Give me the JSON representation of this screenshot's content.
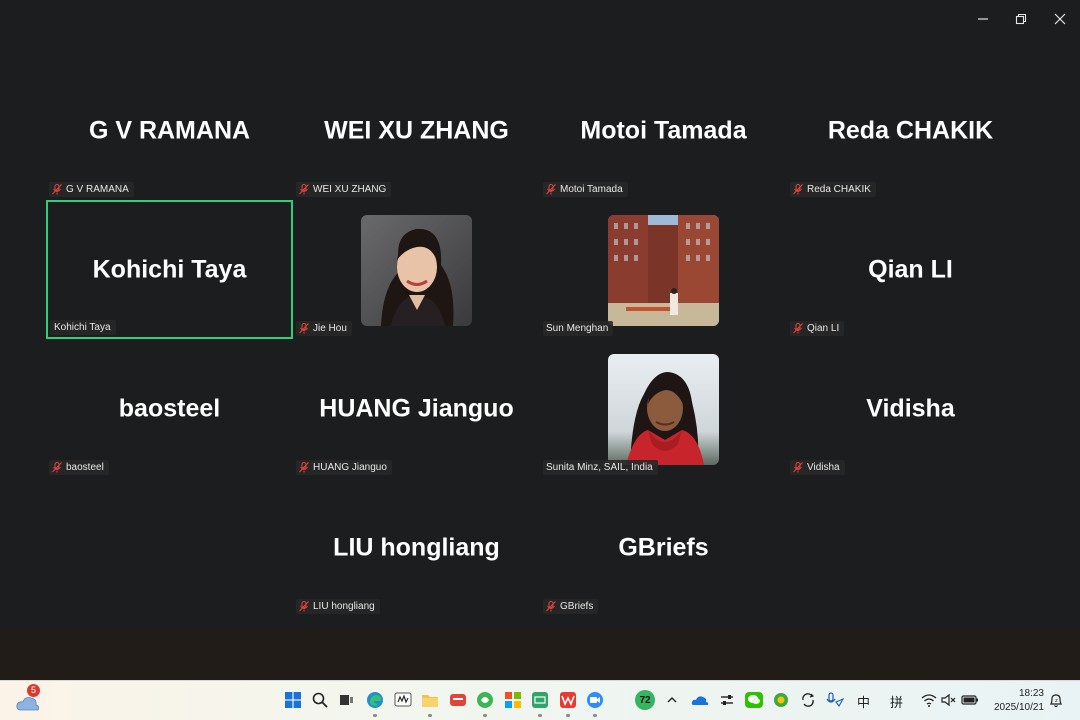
{
  "window": {
    "controls": [
      "minimize",
      "restore",
      "close"
    ]
  },
  "participants": [
    {
      "big": "G V RAMANA",
      "tag": "G V RAMANA"
    },
    {
      "big": "WEI XU  ZHANG",
      "tag": "WEI XU  ZHANG"
    },
    {
      "big": "Motoi Tamada",
      "tag": "Motoi Tamada"
    },
    {
      "big": "Reda CHAKIK",
      "tag": "Reda CHAKIK"
    },
    {
      "big": "Kohichi Taya",
      "tag": "Kohichi Taya"
    },
    {
      "big": "",
      "tag": "Jie Hou"
    },
    {
      "big": "",
      "tag": "Sun Menghan"
    },
    {
      "big": "Qian LI",
      "tag": "Qian LI"
    },
    {
      "big": "baosteel",
      "tag": "baosteel"
    },
    {
      "big": "HUANG Jianguo",
      "tag": "HUANG Jianguo"
    },
    {
      "big": "",
      "tag": "Sunita Minz, SAIL, India"
    },
    {
      "big": "Vidisha",
      "tag": "Vidisha"
    },
    {
      "big": "LIU hongliang",
      "tag": "LIU hongliang"
    },
    {
      "big": "GBriefs",
      "tag": "GBriefs"
    }
  ],
  "colors": {
    "active_speaker_border": "#2fcf7a",
    "muted_icon": "#e0453a"
  },
  "taskbar": {
    "weather_badge": "5",
    "badge_72": "72",
    "ime_label": "中",
    "ime_mode": "拼",
    "time": "18:23",
    "date": "2025/10/21"
  }
}
